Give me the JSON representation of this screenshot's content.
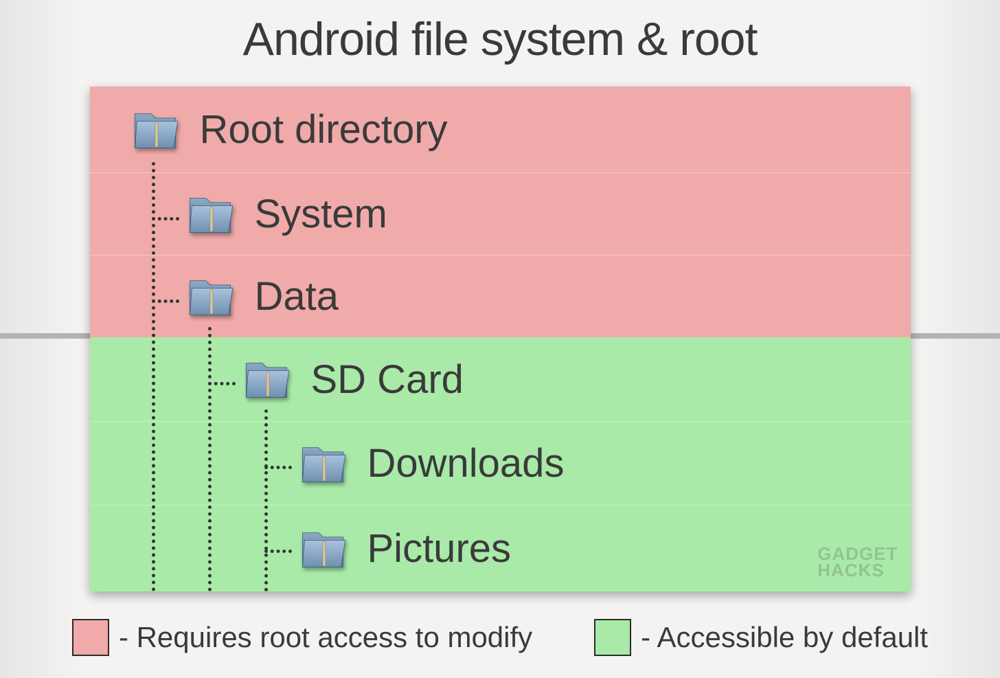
{
  "title": "Android file system & root",
  "colors": {
    "root_bg": "#f0aaaa",
    "default_bg": "#a9eaa9"
  },
  "rows": [
    {
      "label": "Root directory",
      "indent": 0,
      "access": "root"
    },
    {
      "label": "System",
      "indent": 1,
      "access": "root"
    },
    {
      "label": "Data",
      "indent": 1,
      "access": "root"
    },
    {
      "label": "SD Card",
      "indent": 2,
      "access": "default"
    },
    {
      "label": "Downloads",
      "indent": 3,
      "access": "default"
    },
    {
      "label": "Pictures",
      "indent": 3,
      "access": "default"
    }
  ],
  "legend": {
    "root": "- Requires root access to modify",
    "default": "- Accessible by default"
  },
  "watermark": {
    "line1": "GADGET",
    "line2": "HACKS"
  }
}
